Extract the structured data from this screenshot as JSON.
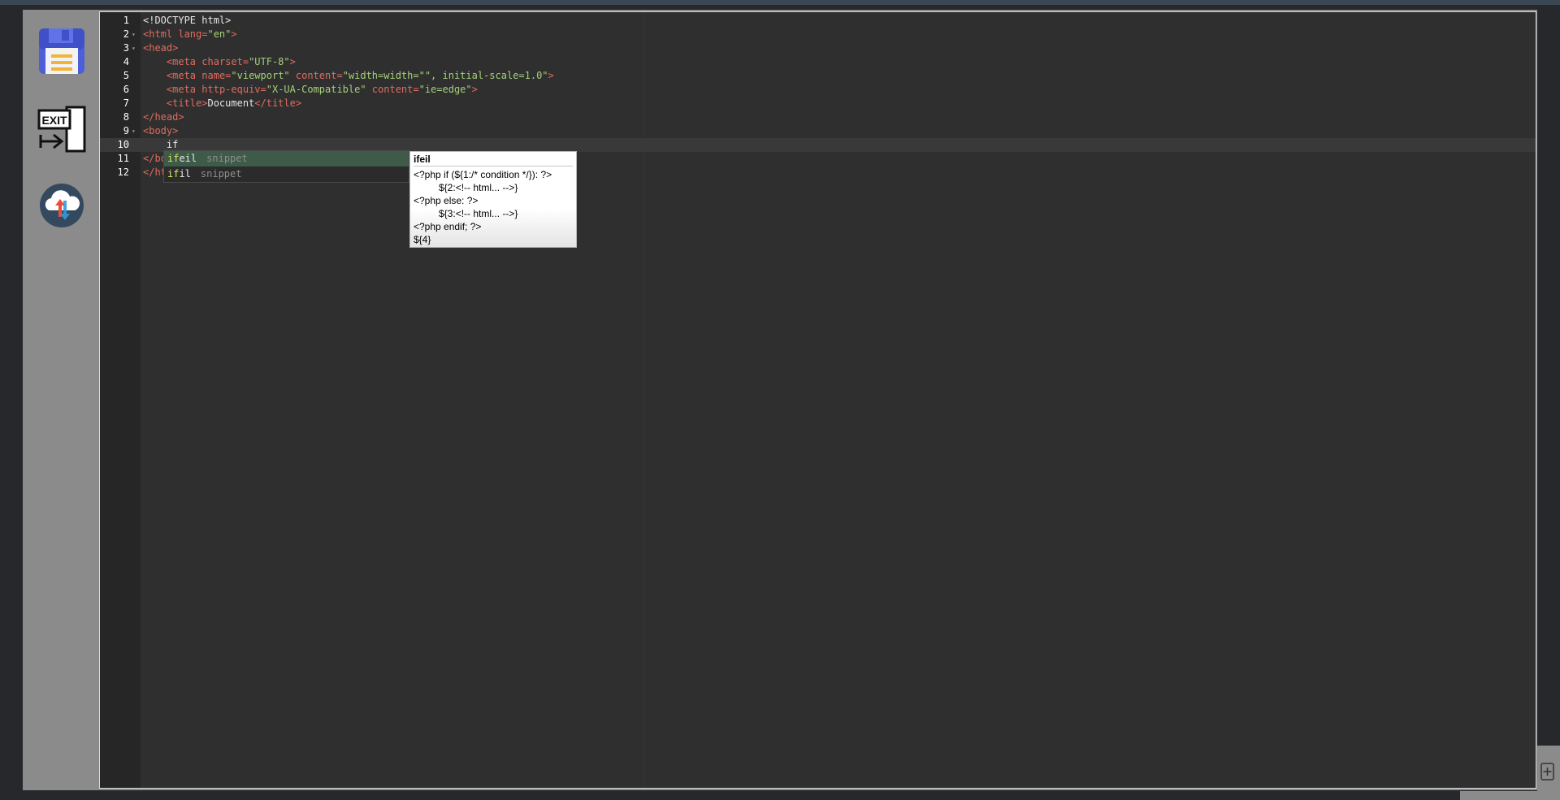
{
  "toolbar": {
    "items": [
      {
        "name": "save",
        "icon": "floppy-disk-icon"
      },
      {
        "name": "exit",
        "icon": "exit-door-icon",
        "label": "EXIT"
      },
      {
        "name": "cloud-sync",
        "icon": "cloud-upload-download-icon"
      }
    ]
  },
  "editor": {
    "active_line": 10,
    "lines": [
      {
        "num": "1",
        "fold": "",
        "parts": [
          {
            "c": "plain",
            "t": "<!DOCTYPE html>"
          }
        ]
      },
      {
        "num": "2",
        "fold": "▾",
        "parts": [
          {
            "c": "tag",
            "t": "<html "
          },
          {
            "c": "attr",
            "t": "lang="
          },
          {
            "c": "str",
            "t": "\"en\""
          },
          {
            "c": "tag",
            "t": ">"
          }
        ]
      },
      {
        "num": "3",
        "fold": "▾",
        "parts": [
          {
            "c": "tag",
            "t": "<head>"
          }
        ]
      },
      {
        "num": "4",
        "fold": "",
        "parts": [
          {
            "c": "plain",
            "t": "    "
          },
          {
            "c": "tag",
            "t": "<meta "
          },
          {
            "c": "attr",
            "t": "charset="
          },
          {
            "c": "str",
            "t": "\"UTF-8\""
          },
          {
            "c": "tag",
            "t": ">"
          }
        ]
      },
      {
        "num": "5",
        "fold": "",
        "parts": [
          {
            "c": "plain",
            "t": "    "
          },
          {
            "c": "tag",
            "t": "<meta "
          },
          {
            "c": "attr",
            "t": "name="
          },
          {
            "c": "str",
            "t": "\"viewport\""
          },
          {
            "c": "attr",
            "t": " content="
          },
          {
            "c": "str",
            "t": "\"width=width=\"\", initial-scale=1.0\""
          },
          {
            "c": "tag",
            "t": ">"
          }
        ]
      },
      {
        "num": "6",
        "fold": "",
        "parts": [
          {
            "c": "plain",
            "t": "    "
          },
          {
            "c": "tag",
            "t": "<meta "
          },
          {
            "c": "attr",
            "t": "http-equiv="
          },
          {
            "c": "str",
            "t": "\"X-UA-Compatible\""
          },
          {
            "c": "attr",
            "t": " content="
          },
          {
            "c": "str",
            "t": "\"ie=edge\""
          },
          {
            "c": "tag",
            "t": ">"
          }
        ]
      },
      {
        "num": "7",
        "fold": "",
        "parts": [
          {
            "c": "plain",
            "t": "    "
          },
          {
            "c": "tag",
            "t": "<title>"
          },
          {
            "c": "plain",
            "t": "Document"
          },
          {
            "c": "tag",
            "t": "</title>"
          }
        ]
      },
      {
        "num": "8",
        "fold": "",
        "parts": [
          {
            "c": "tag",
            "t": "</head>"
          }
        ]
      },
      {
        "num": "9",
        "fold": "▾",
        "parts": [
          {
            "c": "tag",
            "t": "<body>"
          }
        ]
      },
      {
        "num": "10",
        "fold": "",
        "parts": [
          {
            "c": "plain",
            "t": "    if"
          }
        ]
      },
      {
        "num": "11",
        "fold": "",
        "parts": [
          {
            "c": "tag",
            "t": "</body>"
          }
        ]
      },
      {
        "num": "12",
        "fold": "",
        "parts": [
          {
            "c": "tag",
            "t": "</html>"
          }
        ]
      }
    ]
  },
  "autocomplete": {
    "items": [
      {
        "match": "if",
        "rest": "eil",
        "meta": "snippet",
        "selected": true
      },
      {
        "match": "if",
        "rest": "il",
        "meta": "snippet",
        "selected": false
      }
    ]
  },
  "doc_tooltip": {
    "title": "ifeil",
    "lines": [
      {
        "text": "<?php if (${1:/* condition */}): ?>",
        "indent": false
      },
      {
        "text": "${2:<!-- html... -->}",
        "indent": true
      },
      {
        "text": "<?php else: ?>",
        "indent": false
      },
      {
        "text": "${3:<!-- html... -->}",
        "indent": true
      },
      {
        "text": "<?php endif; ?>",
        "indent": false
      },
      {
        "text": "${4}",
        "indent": false
      }
    ]
  },
  "colors": {
    "editor_bg": "#2f2f2f",
    "tag": "#e06c5f",
    "string": "#a5d17a",
    "selection": "#3e5a49",
    "match": "#d9e45a"
  }
}
